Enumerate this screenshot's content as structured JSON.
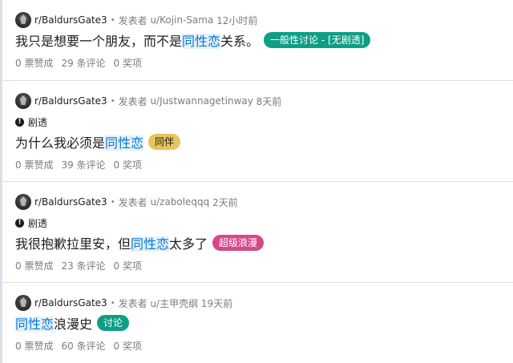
{
  "posts": [
    {
      "subreddit": "r/BaldursGate3",
      "posted_by_label": "发表者",
      "author": "u/Kojin-Sama",
      "age": "12小时前",
      "spoiler": "",
      "title_before": "我只是想要一个朋友，而不是",
      "title_highlight": "同性恋",
      "title_after": "关系。",
      "flair": "一般性讨论 - [无剧透]",
      "flair_bg": "#0e9e85",
      "flair_fg": "#ffffff",
      "votes": "0 票赞成",
      "comments": "29 条评论",
      "awards": "0 奖项"
    },
    {
      "subreddit": "r/BaldursGate3",
      "posted_by_label": "发表者",
      "author": "u/Justwannagetinway",
      "age": "8天前",
      "spoiler": "剧透",
      "title_before": "为什么我必须是",
      "title_highlight": "同性恋",
      "title_after": "",
      "flair": "同伴",
      "flair_bg": "#e6c35c",
      "flair_fg": "#1c1c1c",
      "votes": "0 票赞成",
      "comments": "39 条评论",
      "awards": "0 奖项"
    },
    {
      "subreddit": "r/BaldursGate3",
      "posted_by_label": "发表者",
      "author": "u/zaboleqqq",
      "age": "2天前",
      "spoiler": "剧透",
      "title_before": "我很抱歉拉里安，但",
      "title_highlight": "同性恋",
      "title_after": "太多了",
      "flair": "超级浪漫",
      "flair_bg": "#d44a87",
      "flair_fg": "#ffffff",
      "votes": "0 票赞成",
      "comments": "23 条评论",
      "awards": "0 奖项"
    },
    {
      "subreddit": "r/BaldursGate3",
      "posted_by_label": "发表者",
      "author": "u/主甲壳纲",
      "age": "19天前",
      "spoiler": "",
      "title_before": "",
      "title_highlight": "同性恋",
      "title_after": "浪漫史",
      "flair": "讨论",
      "flair_bg": "#0e9e85",
      "flair_fg": "#ffffff",
      "votes": "0 票赞成",
      "comments": "60 条评论",
      "awards": "0 奖项"
    }
  ]
}
